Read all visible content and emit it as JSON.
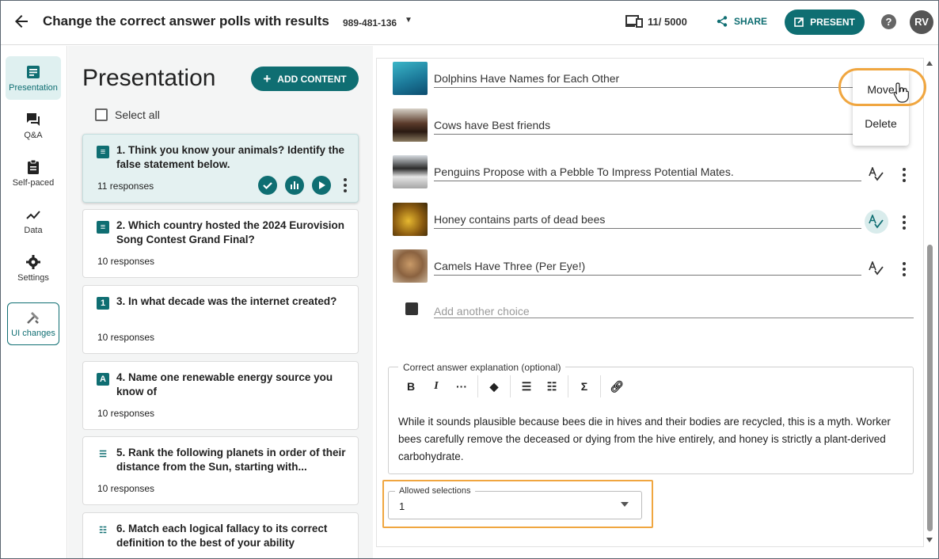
{
  "header": {
    "title": "Change the correct answer polls with results",
    "code": "989-481-136",
    "counter": "11/ 5000",
    "share_label": "SHARE",
    "present_label": "PRESENT",
    "help": "?",
    "avatar": "RV",
    "accent": "#0f6e72"
  },
  "sidebar": {
    "items": [
      {
        "label": "Presentation",
        "icon": "presentation-icon"
      },
      {
        "label": "Q&A",
        "icon": "chat-icon"
      },
      {
        "label": "Self-paced",
        "icon": "clipboard-icon"
      },
      {
        "label": "Data",
        "icon": "trend-icon"
      },
      {
        "label": "Settings",
        "icon": "gear-icon"
      },
      {
        "label": "UI changes",
        "icon": "tools-icon"
      }
    ]
  },
  "left": {
    "title": "Presentation",
    "add_label": "ADD CONTENT",
    "select_all": "Select all",
    "questions": [
      {
        "text": "1. Think you know your animals? Identify the false statement below.",
        "responses": "11 responses",
        "icon": "poll-icon"
      },
      {
        "text": "2. Which country hosted the 2024 Eurovision Song Contest Grand Final?",
        "responses": "10 responses",
        "icon": "poll-icon"
      },
      {
        "text": "3. In what decade was the internet created?",
        "responses": "10 responses",
        "icon": "number-icon"
      },
      {
        "text": "4. Name one renewable energy source you know of",
        "responses": "10 responses",
        "icon": "text-answer-icon"
      },
      {
        "text": "5. Rank the following planets in order of their distance from the Sun, starting with...",
        "responses": "10 responses",
        "icon": "ranking-icon"
      },
      {
        "text": "6. Match each logical fallacy to its correct definition to the best of your ability",
        "responses": "",
        "icon": "matching-icon"
      }
    ]
  },
  "choices": [
    {
      "text": "Dolphins Have Names for Each Other"
    },
    {
      "text": "Cows have Best friends"
    },
    {
      "text": "Penguins Propose with a Pebble To Impress Potential Mates."
    },
    {
      "text": "Honey contains parts of dead bees"
    },
    {
      "text": "Camels Have Three (Per Eye!)"
    }
  ],
  "add_choice_placeholder": "Add another choice",
  "explanation": {
    "label": "Correct answer explanation (optional)",
    "text": "While it sounds plausible because bees die in hives and their bodies are recycled, this is a myth. Worker bees carefully remove the deceased or dying from the hive entirely, and honey is strictly a plant-derived carbohydrate."
  },
  "allowed_selections": {
    "label": "Allowed selections",
    "value": "1"
  },
  "context_menu": {
    "move": "Move",
    "delete": "Delete"
  }
}
